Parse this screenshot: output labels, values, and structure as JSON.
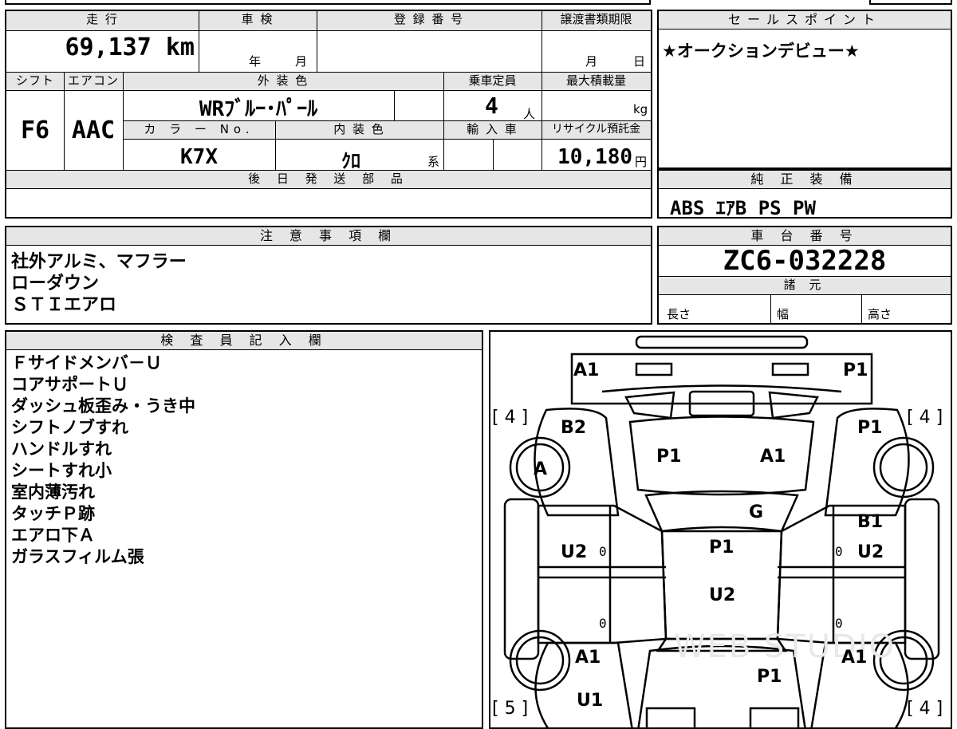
{
  "basic": {
    "mileage_label": "走 行",
    "mileage_value": "69,137 km",
    "inspection_label": "車 検",
    "inspection_year": "年",
    "inspection_month": "月",
    "registration_label": "登 録 番 号",
    "transfer_label": "譲渡書類期限",
    "transfer_month": "月",
    "transfer_day": "日",
    "shift_label": "シフト",
    "ac_label": "エアコン",
    "shift_value": "F6",
    "ac_value": "AAC",
    "exterior_color_label": "外 装 色",
    "exterior_color_value": "WRﾌﾞﾙｰ･ﾊﾟｰﾙ",
    "capacity_label": "乗車定員",
    "capacity_value": "4",
    "capacity_unit": "人",
    "max_load_label": "最大積載量",
    "max_load_unit": "kg",
    "color_no_label": "カ ラ ー No.",
    "color_no_value": "K7X",
    "interior_color_label": "内 装 色",
    "interior_color_value": "ｸﾛ",
    "interior_color_suffix": "系",
    "import_label": "輸 入 車",
    "recycle_label": "リサイクル預託金",
    "recycle_value": "10,180",
    "recycle_unit": "円",
    "later_parts_label": "後 日 発 送 部 品"
  },
  "sales": {
    "label": "セールスポイント",
    "text": "★オークションデビュー★"
  },
  "equipment": {
    "label": "純 正 装 備",
    "value": "ABS ｴｱB PS PW"
  },
  "notes": {
    "label": "注 意 事 項 欄",
    "lines": [
      "社外アルミ、マフラー",
      "ローダウン",
      "ＳＴＩエアロ"
    ]
  },
  "chassis": {
    "label": "車 台 番 号",
    "value": "ZC6-032228",
    "spec_label": "諸 元",
    "length_label": "長さ",
    "width_label": "幅",
    "height_label": "高さ"
  },
  "inspector": {
    "label": "検 査 員 記 入 欄",
    "lines": [
      "Ｆサイドメンバ－Ｕ",
      "コアサポートＵ",
      "ダッシュ板歪み・うき中",
      "シフトノブすれ",
      "ハンドルすれ",
      "シートすれ小",
      "室内薄汚れ",
      "タッチＰ跡",
      "エアロ下Ａ",
      "ガラスフィルム張"
    ]
  },
  "diagram": {
    "marks": {
      "front_left": "A1",
      "front_right": "P1",
      "fender_left": "B2",
      "hood_left": "P1",
      "hood_right": "A1",
      "wheel_front_left": "A",
      "windshield": "G",
      "pillar_right": "B1",
      "door_front_left": "U2",
      "roof": "P1",
      "door_front_right": "U2",
      "roof_rear": "U2",
      "rear_fender_left": "A1",
      "rear_fender_right": "A1",
      "trunk": "P1",
      "rear_left": "U1"
    },
    "tires": {
      "front_left": "[ 4 ]",
      "front_right": "[ 4 ]",
      "rear_left": "[ 5 ]",
      "rear_right": "[ 4 ]"
    },
    "zeros": [
      "0",
      "0",
      "0",
      "0"
    ],
    "watermark": "WEB STUDIO"
  }
}
